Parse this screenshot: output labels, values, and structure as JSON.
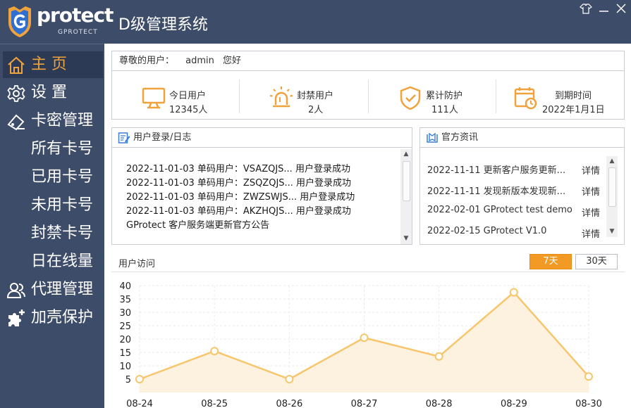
{
  "app": {
    "logo_word": "protect",
    "logo_sub": "GPROTECT",
    "title": "D级管理系统"
  },
  "sidebar": {
    "items": [
      {
        "label": "主 页",
        "icon": "home-icon",
        "active": true
      },
      {
        "label": "设 置",
        "icon": "gear-icon"
      },
      {
        "label": "卡密管理",
        "icon": "card-key-icon"
      },
      {
        "label": "所有卡号",
        "sub": true
      },
      {
        "label": "已用卡号",
        "sub": true
      },
      {
        "label": "未用卡号",
        "sub": true
      },
      {
        "label": "封禁卡号",
        "sub": true
      },
      {
        "label": "日在线量",
        "sub": true
      },
      {
        "label": "代理管理",
        "icon": "agents-icon"
      },
      {
        "label": "加壳保护",
        "icon": "puzzle-plus-icon"
      }
    ]
  },
  "welcome": {
    "greeting_prefix": "尊敬的用户：",
    "username": "admin",
    "greeting_suffix": "您好",
    "stats": [
      {
        "label": "今日用户",
        "value": "12345人",
        "icon": "monitor-icon"
      },
      {
        "label": "封禁用户",
        "value": "2人",
        "icon": "alarm-light-icon"
      },
      {
        "label": "累计防护",
        "value": "111人",
        "icon": "shield-check-icon"
      },
      {
        "label": "到期时间",
        "value": "2022年1月1日",
        "icon": "calendar-clock-icon"
      }
    ]
  },
  "log": {
    "title": "用户登录/日志",
    "lines": [
      "2022-11-01-03 单码用户：VSAZQJS... 用户登录成功",
      "2022-11-01-03 单码用户：ZSQZQJS... 用户登录成功",
      "2022-11-01-03 单码用户：ZWZSWJS... 用户登录成功",
      "2022-11-01-03 单码用户：AKZHQJS... 用户登录成功",
      "GProtect 客户服务端更新官方公告"
    ]
  },
  "news": {
    "title": "官方资讯",
    "items": [
      {
        "text": "2022-11-11 更新客户服务更新...",
        "more": "详情"
      },
      {
        "text": "2022-11-11 发现新版本发现新...",
        "more": "详情"
      },
      {
        "text": "2022-02-01 GProtect test demo",
        "more": "详情"
      },
      {
        "text": "2022-02-15 GProtect V1.0",
        "more": "详情"
      }
    ]
  },
  "visits": {
    "title": "用户访问",
    "ranges": [
      "7天",
      "30天"
    ],
    "active_range": "7天"
  },
  "colors": {
    "accent": "#f39a24",
    "sidebar": "#3d4c68",
    "line": "#f7c56b",
    "area": "#fdf1dc"
  },
  "chart_data": {
    "type": "area",
    "categories": [
      "08-24",
      "08-25",
      "08-26",
      "08-27",
      "08-28",
      "08-29",
      "08-30"
    ],
    "series": [
      {
        "values": [
          5,
          15.5,
          5,
          20.5,
          13.5,
          37.5,
          6
        ]
      }
    ],
    "yticks": [
      5,
      10,
      15,
      20,
      25,
      30,
      35,
      40
    ],
    "ylim": [
      0,
      40
    ],
    "grid": true
  }
}
